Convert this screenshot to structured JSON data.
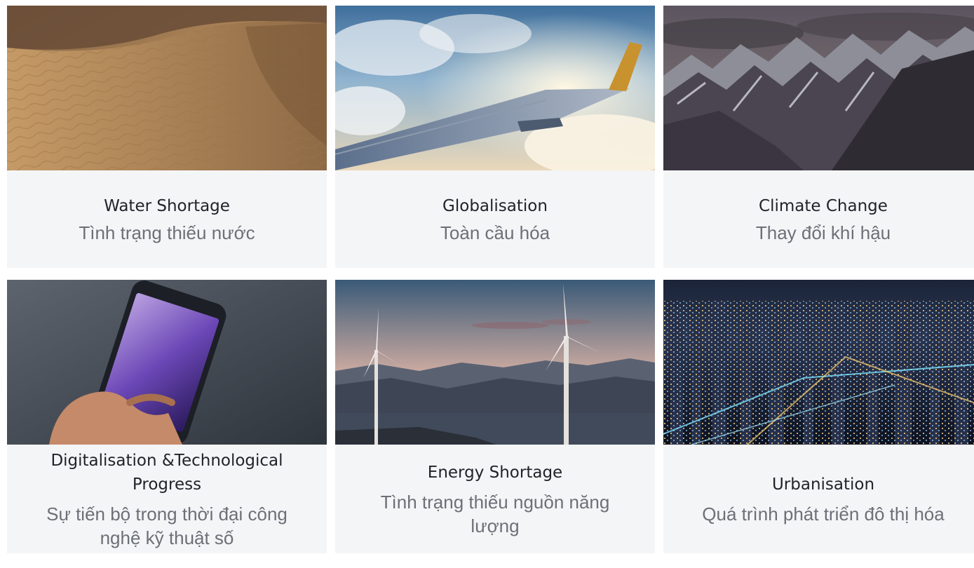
{
  "cards": [
    {
      "title": "Water Shortage",
      "subtitle": "Tình trạng thiếu nước",
      "image": "desert-dunes"
    },
    {
      "title": "Globalisation",
      "subtitle": "Toàn cầu hóa",
      "image": "airplane-wing"
    },
    {
      "title": "Climate Change",
      "subtitle": "Thay đổi khí hậu",
      "image": "snowy-mountains"
    },
    {
      "title": "Digitalisation &Technological Progress",
      "subtitle": "Sự tiến bộ trong thời đại công nghệ kỹ thuật số",
      "image": "hand-smartphone"
    },
    {
      "title": "Energy Shortage",
      "subtitle": "Tình trạng thiếu nguồn năng lượng",
      "image": "wind-turbines"
    },
    {
      "title": "Urbanisation",
      "subtitle": "Quá trình phát triển đô thị hóa",
      "image": "city-night"
    }
  ],
  "colors": {
    "card_background": "#f4f5f7",
    "title": "#1f2329",
    "subtitle": "#6c7077"
  }
}
